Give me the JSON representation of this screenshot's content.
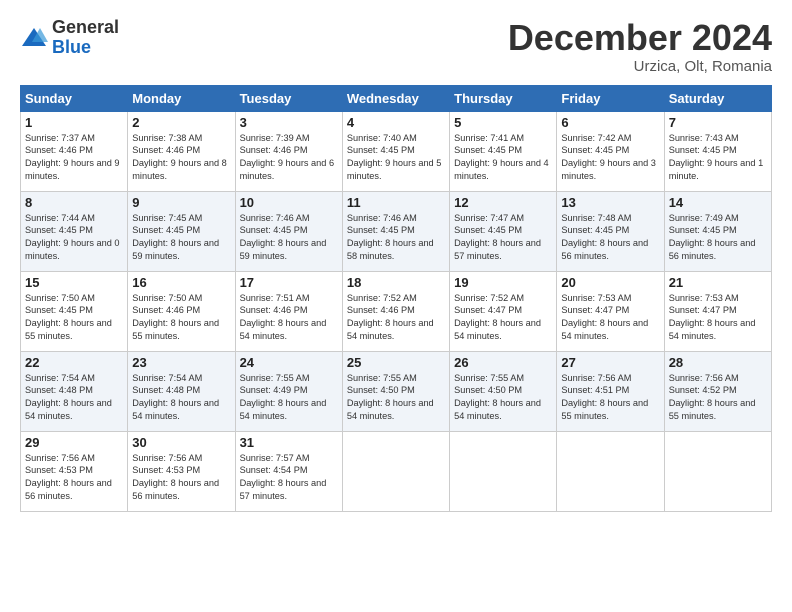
{
  "logo": {
    "general": "General",
    "blue": "Blue"
  },
  "title": "December 2024",
  "location": "Urzica, Olt, Romania",
  "headers": [
    "Sunday",
    "Monday",
    "Tuesday",
    "Wednesday",
    "Thursday",
    "Friday",
    "Saturday"
  ],
  "weeks": [
    [
      {
        "day": "1",
        "rise": "7:37 AM",
        "set": "4:46 PM",
        "daylight": "9 hours and 9 minutes."
      },
      {
        "day": "2",
        "rise": "7:38 AM",
        "set": "4:46 PM",
        "daylight": "9 hours and 8 minutes."
      },
      {
        "day": "3",
        "rise": "7:39 AM",
        "set": "4:46 PM",
        "daylight": "9 hours and 6 minutes."
      },
      {
        "day": "4",
        "rise": "7:40 AM",
        "set": "4:45 PM",
        "daylight": "9 hours and 5 minutes."
      },
      {
        "day": "5",
        "rise": "7:41 AM",
        "set": "4:45 PM",
        "daylight": "9 hours and 4 minutes."
      },
      {
        "day": "6",
        "rise": "7:42 AM",
        "set": "4:45 PM",
        "daylight": "9 hours and 3 minutes."
      },
      {
        "day": "7",
        "rise": "7:43 AM",
        "set": "4:45 PM",
        "daylight": "9 hours and 1 minute."
      }
    ],
    [
      {
        "day": "8",
        "rise": "7:44 AM",
        "set": "4:45 PM",
        "daylight": "9 hours and 0 minutes."
      },
      {
        "day": "9",
        "rise": "7:45 AM",
        "set": "4:45 PM",
        "daylight": "8 hours and 59 minutes."
      },
      {
        "day": "10",
        "rise": "7:46 AM",
        "set": "4:45 PM",
        "daylight": "8 hours and 59 minutes."
      },
      {
        "day": "11",
        "rise": "7:46 AM",
        "set": "4:45 PM",
        "daylight": "8 hours and 58 minutes."
      },
      {
        "day": "12",
        "rise": "7:47 AM",
        "set": "4:45 PM",
        "daylight": "8 hours and 57 minutes."
      },
      {
        "day": "13",
        "rise": "7:48 AM",
        "set": "4:45 PM",
        "daylight": "8 hours and 56 minutes."
      },
      {
        "day": "14",
        "rise": "7:49 AM",
        "set": "4:45 PM",
        "daylight": "8 hours and 56 minutes."
      }
    ],
    [
      {
        "day": "15",
        "rise": "7:50 AM",
        "set": "4:45 PM",
        "daylight": "8 hours and 55 minutes."
      },
      {
        "day": "16",
        "rise": "7:50 AM",
        "set": "4:46 PM",
        "daylight": "8 hours and 55 minutes."
      },
      {
        "day": "17",
        "rise": "7:51 AM",
        "set": "4:46 PM",
        "daylight": "8 hours and 54 minutes."
      },
      {
        "day": "18",
        "rise": "7:52 AM",
        "set": "4:46 PM",
        "daylight": "8 hours and 54 minutes."
      },
      {
        "day": "19",
        "rise": "7:52 AM",
        "set": "4:47 PM",
        "daylight": "8 hours and 54 minutes."
      },
      {
        "day": "20",
        "rise": "7:53 AM",
        "set": "4:47 PM",
        "daylight": "8 hours and 54 minutes."
      },
      {
        "day": "21",
        "rise": "7:53 AM",
        "set": "4:47 PM",
        "daylight": "8 hours and 54 minutes."
      }
    ],
    [
      {
        "day": "22",
        "rise": "7:54 AM",
        "set": "4:48 PM",
        "daylight": "8 hours and 54 minutes."
      },
      {
        "day": "23",
        "rise": "7:54 AM",
        "set": "4:48 PM",
        "daylight": "8 hours and 54 minutes."
      },
      {
        "day": "24",
        "rise": "7:55 AM",
        "set": "4:49 PM",
        "daylight": "8 hours and 54 minutes."
      },
      {
        "day": "25",
        "rise": "7:55 AM",
        "set": "4:50 PM",
        "daylight": "8 hours and 54 minutes."
      },
      {
        "day": "26",
        "rise": "7:55 AM",
        "set": "4:50 PM",
        "daylight": "8 hours and 54 minutes."
      },
      {
        "day": "27",
        "rise": "7:56 AM",
        "set": "4:51 PM",
        "daylight": "8 hours and 55 minutes."
      },
      {
        "day": "28",
        "rise": "7:56 AM",
        "set": "4:52 PM",
        "daylight": "8 hours and 55 minutes."
      }
    ],
    [
      {
        "day": "29",
        "rise": "7:56 AM",
        "set": "4:53 PM",
        "daylight": "8 hours and 56 minutes."
      },
      {
        "day": "30",
        "rise": "7:56 AM",
        "set": "4:53 PM",
        "daylight": "8 hours and 56 minutes."
      },
      {
        "day": "31",
        "rise": "7:57 AM",
        "set": "4:54 PM",
        "daylight": "8 hours and 57 minutes."
      },
      null,
      null,
      null,
      null
    ]
  ],
  "labels": {
    "sunrise": "Sunrise:",
    "sunset": "Sunset:",
    "daylight": "Daylight:"
  }
}
